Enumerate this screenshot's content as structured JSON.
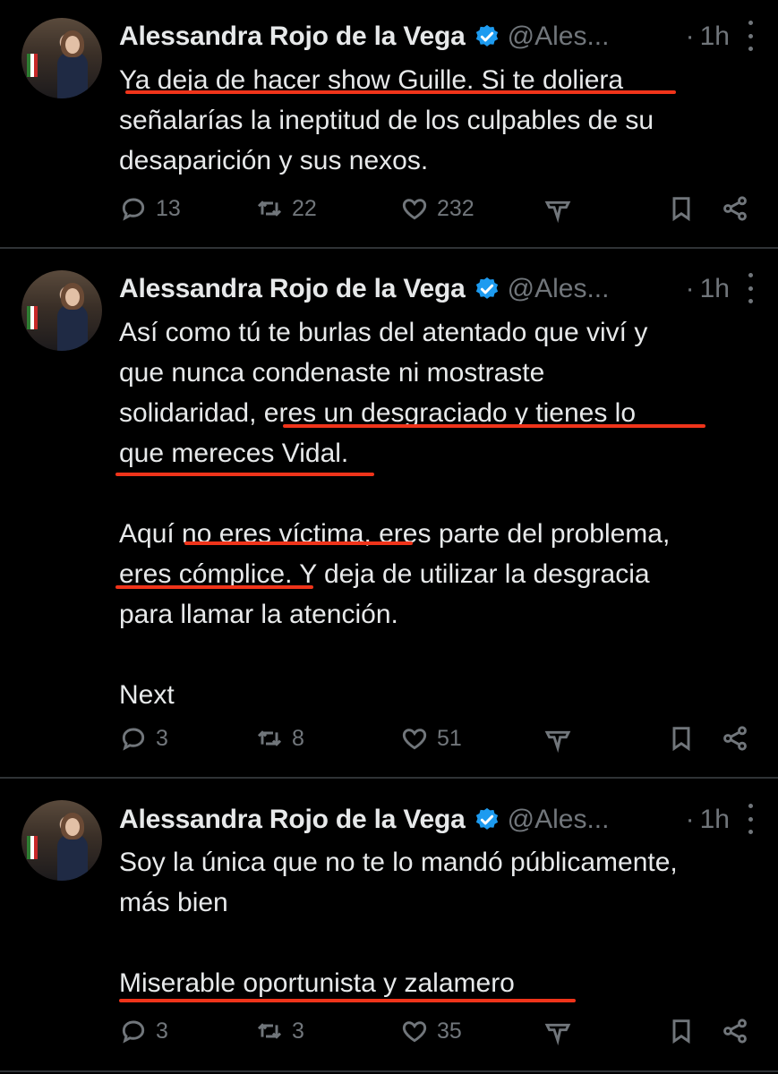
{
  "tweets": [
    {
      "author": "Alessandra Rojo de la Vega",
      "handle": "@Ales...",
      "dot": "·",
      "time": "1h",
      "lines": [
        "Ya deja de hacer show Guille. Si te doliera",
        "señalarías la ineptitud de los culpables de su",
        "desaparición y sus nexos."
      ],
      "replies": "13",
      "reposts": "22",
      "likes": "232"
    },
    {
      "author": "Alessandra Rojo de la Vega",
      "handle": "@Ales...",
      "dot": "·",
      "time": "1h",
      "lines": [
        "Así como tú te burlas del atentado que viví y",
        "que nunca condenaste ni mostraste",
        "solidaridad, eres un desgraciado y tienes lo",
        "que mereces Vidal.",
        "",
        "Aquí no eres víctima, eres parte del problema,",
        "eres cómplice. Y deja de utilizar la desgracia",
        "para llamar la atención.",
        "",
        "Next"
      ],
      "replies": "3",
      "reposts": "8",
      "likes": "51"
    },
    {
      "author": "Alessandra Rojo de la Vega",
      "handle": "@Ales...",
      "dot": "·",
      "time": "1h",
      "lines": [
        "Soy la única que no te lo mandó públicamente,",
        "más bien",
        "",
        "Miserable oportunista y zalamero"
      ],
      "replies": "3",
      "reposts": "3",
      "likes": "35"
    }
  ],
  "colors": {
    "highlight": "#f0341a",
    "verified": "#1d9bf0",
    "muted": "#71767b",
    "text": "#e7e9ea"
  },
  "icons": [
    "reply-icon",
    "repost-icon",
    "like-icon",
    "stats-icon",
    "bookmark-icon",
    "share-icon",
    "verified-badge-icon",
    "more-icon"
  ]
}
